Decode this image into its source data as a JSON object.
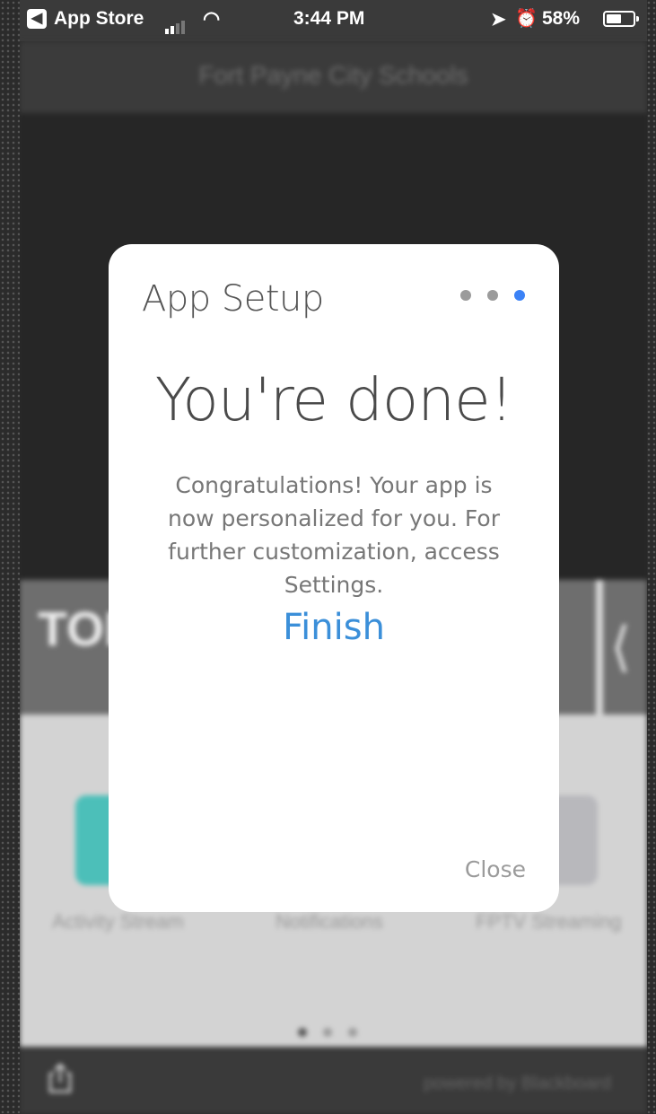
{
  "status_bar": {
    "back_app": "App Store",
    "time": "3:44 PM",
    "battery_percent": "58%",
    "battery_level": 0.58
  },
  "background_app": {
    "title": "Fort Payne City Schools",
    "banner_title": "TOP",
    "tile_labels": [
      "Activity Stream",
      "Notifications",
      "FPTV Streaming"
    ],
    "footer": "powered by Blackboard"
  },
  "modal": {
    "title": "App Setup",
    "step_count": 3,
    "current_step": 3,
    "heading": "You're done!",
    "message": "Congratulations! Your app is now personalized for you. For further customization, access Settings.",
    "finish_label": "Finish",
    "close_label": "Close",
    "colors": {
      "accent": "#3b8fd9",
      "active_step": "#3b82f6"
    }
  }
}
